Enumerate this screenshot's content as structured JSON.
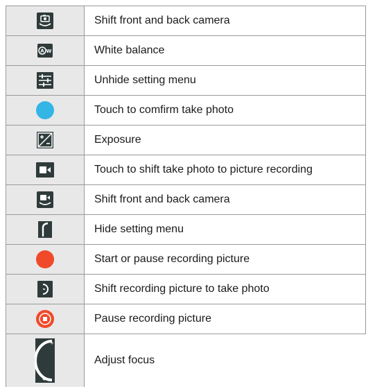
{
  "rows": [
    {
      "icon": "camera-switch-icon",
      "label": "Shift front and back camera"
    },
    {
      "icon": "white-balance-icon",
      "label": "White balance"
    },
    {
      "icon": "settings-sliders-icon",
      "label": "Unhide setting menu"
    },
    {
      "icon": "shutter-blue-icon",
      "label": "Touch to comfirm take photo"
    },
    {
      "icon": "exposure-icon",
      "label": "Exposure"
    },
    {
      "icon": "video-camera-icon",
      "label": "Touch to shift take photo to picture recording"
    },
    {
      "icon": "video-switch-icon",
      "label": "Shift front and back camera"
    },
    {
      "icon": "hide-menu-icon",
      "label": "Hide setting menu"
    },
    {
      "icon": "record-red-icon",
      "label": "Start or pause recording picture"
    },
    {
      "icon": "photo-mode-icon",
      "label": "Shift recording picture to take photo"
    },
    {
      "icon": "pause-record-icon",
      "label": "Pause recording picture"
    },
    {
      "icon": "focus-dial-icon",
      "label": "Adjust focus"
    }
  ],
  "colors": {
    "icon_dark": "#2f3b3b",
    "shutter_blue": "#33b5e5",
    "record_red": "#f04a2a",
    "icon_cell_bg": "#e8e8e8",
    "border": "#9a9a9a"
  }
}
